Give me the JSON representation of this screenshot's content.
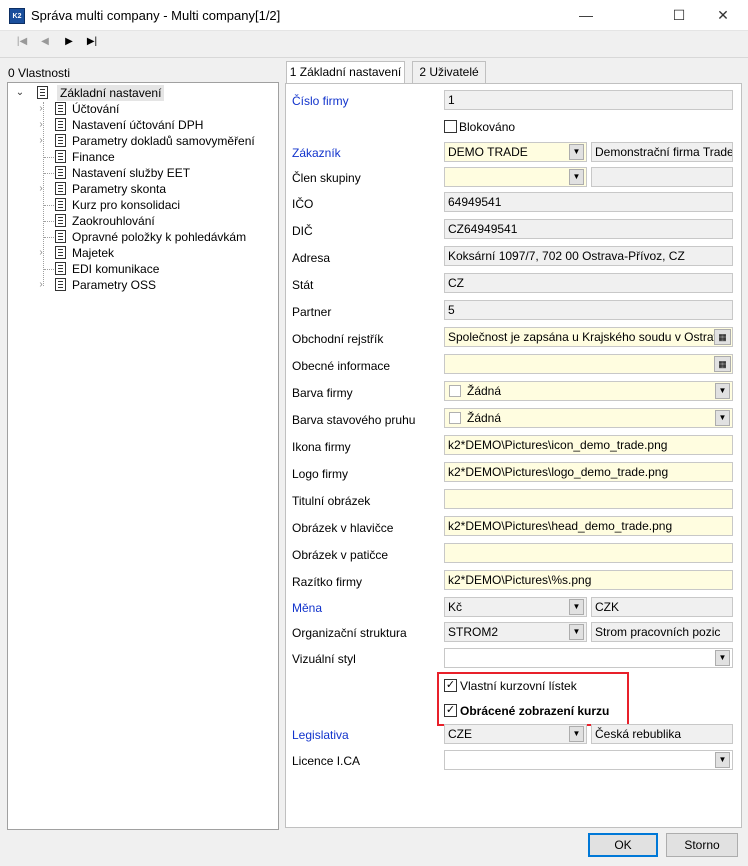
{
  "window": {
    "title": "Správa multi company - Multi company[1/2]",
    "app_icon_text": "K2",
    "minimize": "—",
    "maximize": "☐",
    "close": "✕"
  },
  "nav": {
    "first": "|◀",
    "prev": "◀",
    "next": "▶",
    "last": "▶|"
  },
  "left_panel": {
    "label": "0 Vlastnosti",
    "root": "Základní nastavení",
    "items": [
      "Účtování",
      "Nastavení účtování DPH",
      "Parametry dokladů samovyměření",
      "Finance",
      "Nastavení služby EET",
      "Parametry skonta",
      "Kurz pro konsolidaci",
      "Zaokrouhlování",
      "Opravné položky k pohledávkám",
      "Majetek",
      "EDI komunikace",
      "Parametry OSS"
    ]
  },
  "tabs": [
    "1 Základní nastavení",
    "2 Uživatelé"
  ],
  "form": {
    "cislo_firmy": {
      "label": "Číslo firmy",
      "value": "1"
    },
    "blokovano": {
      "label": "Blokováno"
    },
    "zakaznik": {
      "label": "Zákazník",
      "value": "DEMO TRADE",
      "value2": "Demonstrační firma Trade, sp"
    },
    "clen_skupiny": {
      "label": "Člen skupiny",
      "value": "",
      "value2": ""
    },
    "ico": {
      "label": "IČO",
      "value": "64949541"
    },
    "dic": {
      "label": "DIČ",
      "value": "CZ64949541"
    },
    "adresa": {
      "label": "Adresa",
      "value": "Koksární 1097/7, 702 00  Ostrava-Přívoz, CZ"
    },
    "stat": {
      "label": "Stát",
      "value": "CZ"
    },
    "partner": {
      "label": "Partner",
      "value": "5"
    },
    "obchodni_rejstrik": {
      "label": "Obchodní rejstřík",
      "value": "Společnost je zapsána u Krajského soudu v Ostravě, o"
    },
    "obecne_informace": {
      "label": "Obecné informace",
      "value": ""
    },
    "barva_firmy": {
      "label": "Barva firmy",
      "value": "Žádná"
    },
    "barva_stavoveho_pruhu": {
      "label": "Barva stavového pruhu",
      "value": "Žádná"
    },
    "ikona_firmy": {
      "label": "Ikona firmy",
      "value": "k2*DEMO\\Pictures\\icon_demo_trade.png"
    },
    "logo_firmy": {
      "label": "Logo firmy",
      "value": "k2*DEMO\\Pictures\\logo_demo_trade.png"
    },
    "titulni_obrazek": {
      "label": "Titulní obrázek",
      "value": ""
    },
    "obrazek_v_hlavicce": {
      "label": "Obrázek v hlavičce",
      "value": "k2*DEMO\\Pictures\\head_demo_trade.png"
    },
    "obrazek_v_paticce": {
      "label": "Obrázek v patičce",
      "value": ""
    },
    "razitko_firmy": {
      "label": "Razítko firmy",
      "value": "k2*DEMO\\Pictures\\%s.png"
    },
    "mena": {
      "label": "Měna",
      "value": "Kč",
      "value2": "CZK"
    },
    "organizacni_struktura": {
      "label": "Organizační struktura",
      "value": "STROM2",
      "value2": "Strom pracovních pozic"
    },
    "vizualni_styl": {
      "label": "Vizuální styl",
      "value": ""
    },
    "vlastni_kurzovni_listek": {
      "label": "Vlastní kurzovní lístek",
      "checked": "✓"
    },
    "obracene_zobrazeni_kurzu": {
      "label": "Obrácené zobrazení kurzu",
      "checked": "✓"
    },
    "legislativa": {
      "label": "Legislativa",
      "value": "CZE",
      "value2": "Česká rebublika"
    },
    "licence_ica": {
      "label": "Licence I.CA",
      "value": ""
    }
  },
  "buttons": {
    "ok": "OK",
    "storno": "Storno"
  },
  "icons": {
    "dropdown": "▼",
    "ellipsis": "▦"
  }
}
